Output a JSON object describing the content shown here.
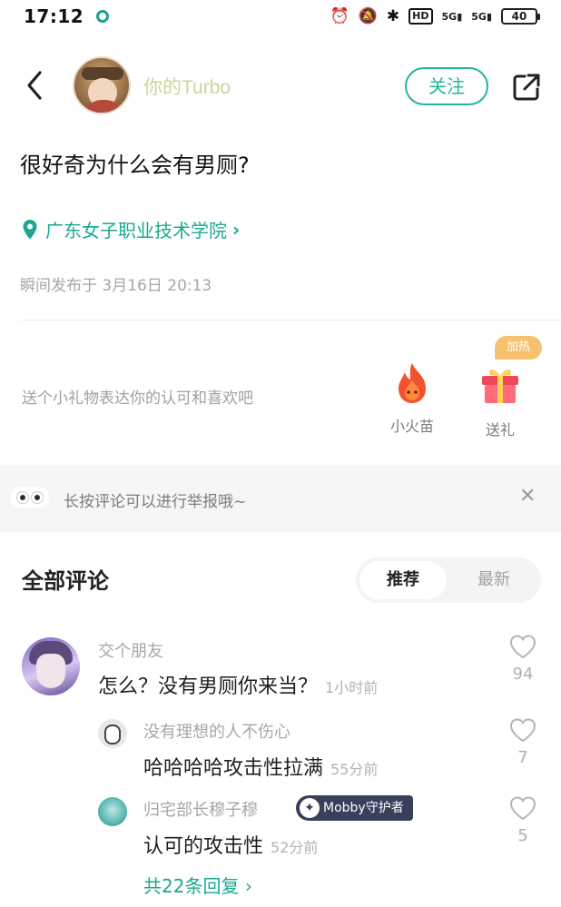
{
  "status_bar": {
    "time": "17:12",
    "battery": "40",
    "network_1": "5G",
    "network_2": "5G",
    "hd": "HD"
  },
  "header": {
    "username": "你的Turbo",
    "follow_label": "关注"
  },
  "post": {
    "title": "很好奇为什么会有男厕?",
    "location": "广东女子职业技术学院",
    "time": "瞬间发布于 3月16日 20:13"
  },
  "gifts": {
    "hint": "送个小礼物表达你的认可和喜欢吧",
    "flame_label": "小火苗",
    "gift_label": "送礼",
    "hot_badge": "加热"
  },
  "report_notice": {
    "text": "长按评论可以进行举报哦~"
  },
  "comments_section": {
    "title": "全部评论",
    "tabs": [
      {
        "label": "推荐",
        "active": true
      },
      {
        "label": "最新",
        "active": false
      }
    ],
    "comments": [
      {
        "name": "交个朋友",
        "text": "怎么？没有男厕你来当？",
        "time": "1小时前",
        "likes": "94"
      }
    ],
    "replies": [
      {
        "name": "没有理想的人不伤心",
        "text": "哈哈哈哈攻击性拉满",
        "time": "55分前",
        "likes": "7"
      },
      {
        "name": "归宅部长穆子穆",
        "badge": "Mobby守护者",
        "text": "认可的攻击性",
        "time": "52分前",
        "likes": "5"
      }
    ],
    "more_replies": "共22条回复"
  },
  "colors": {
    "accent": "#1aa98f",
    "follow_border": "#23b59b",
    "username": "#c8d79a",
    "hot_badge": "#f5c16e",
    "badge_bg": "#3a3f5c"
  },
  "icons": {
    "back": "chevron-left-icon",
    "share": "share-external-icon",
    "location": "location-pin-icon",
    "flame": "flame-icon",
    "gift": "gift-box-icon",
    "close": "close-icon",
    "like": "heart-outline-icon"
  }
}
